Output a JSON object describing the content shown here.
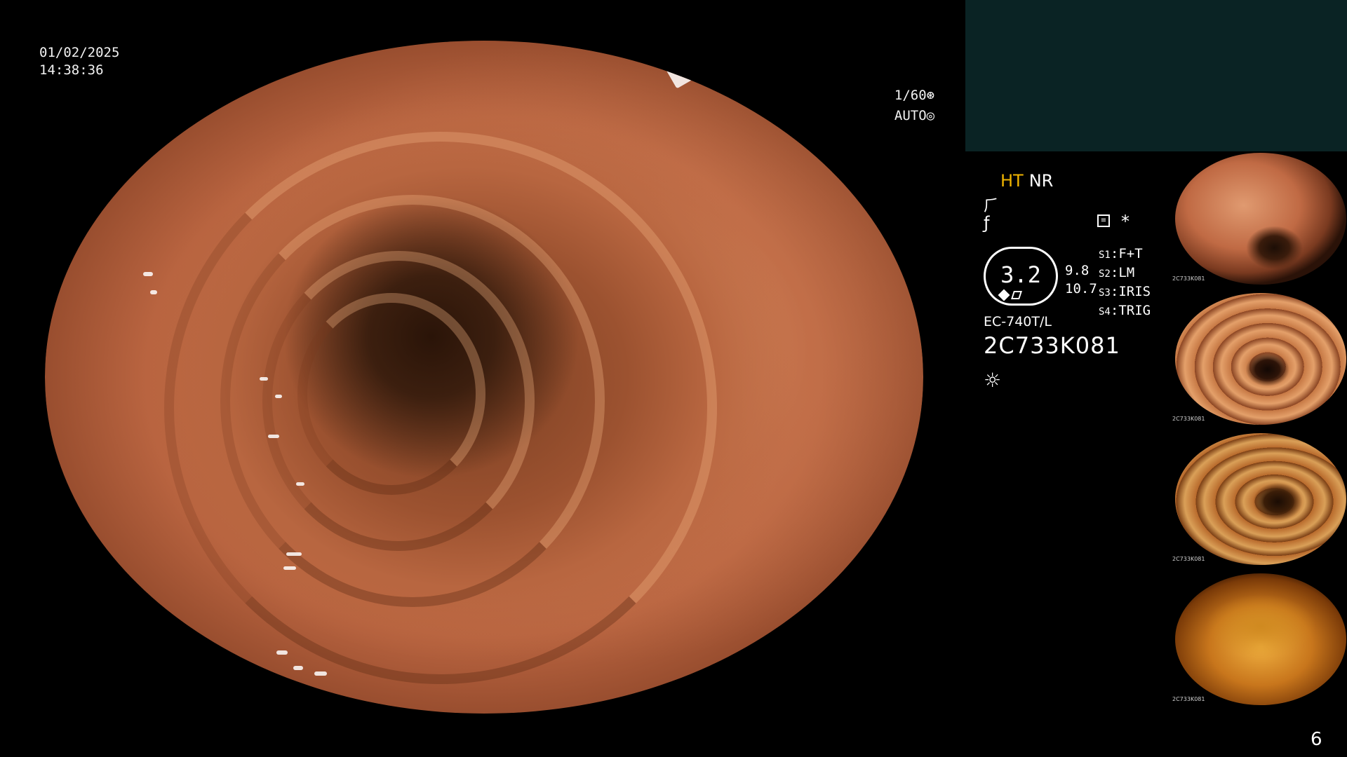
{
  "datetime": {
    "date": "01/02/2025",
    "time": "14:38:36"
  },
  "exposure": {
    "shutter": "1/60",
    "shutter_icon": "shutter-icon",
    "mode": "AUTO",
    "mode_icon": "iris-icon"
  },
  "status": {
    "ht_label": "HT",
    "nr_label": "NR",
    "ht_color": "#f0b400",
    "icons": [
      "enhance-curve-icon",
      "gamma-curve-icon",
      "menu-icon",
      "asterisk-icon",
      "light-source-icon"
    ]
  },
  "zoom": {
    "value": "3.2",
    "side_top": "9.8",
    "side_bottom": "10.7"
  },
  "switches": [
    {
      "key": "S1",
      "value": "F+T"
    },
    {
      "key": "S2",
      "value": "LM"
    },
    {
      "key": "S3",
      "value": "IRIS"
    },
    {
      "key": "S4",
      "value": "TRIG"
    }
  ],
  "scope": {
    "model": "EC-740T/L",
    "serial": "2C733K081"
  },
  "thumbnails": [
    {
      "label": "2C733K081"
    },
    {
      "label": "2C733K081"
    },
    {
      "label": "2C733K081"
    },
    {
      "label": "2C733K081"
    }
  ],
  "page_number": "6",
  "colors": {
    "background": "#000000",
    "thumb_band": "#0a2324",
    "text": "#ffffff"
  }
}
